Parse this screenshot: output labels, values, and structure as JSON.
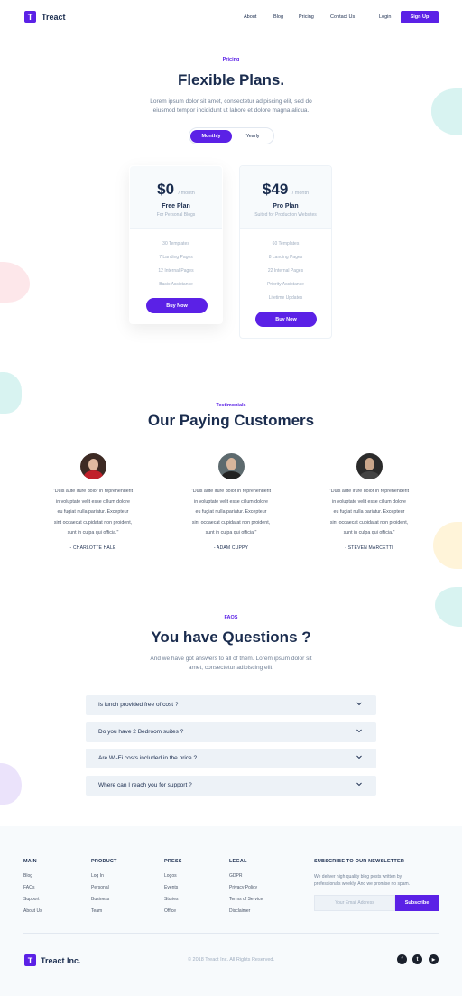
{
  "brand": {
    "logo_letter": "T",
    "name": "Treact",
    "footer_name": "Treact Inc.",
    "accent": "#5b21e6"
  },
  "nav": {
    "about": "About",
    "blog": "Blog",
    "pricing": "Pricing",
    "contact": "Contact Us",
    "login": "Login",
    "signup": "Sign Up"
  },
  "pricing": {
    "label": "Pricing",
    "title": "Flexible Plans.",
    "desc_1": "Lorem ipsum dolor sit amet, consectetur adipiscing elit, sed do",
    "desc_2": "eiusmod tempor incididunt ut labore et dolore magna aliqua.",
    "toggle": {
      "monthly": "Monthly",
      "yearly": "Yearly"
    },
    "plans": [
      {
        "price": "$0",
        "per": "/ month",
        "name": "Free Plan",
        "sub": "For Personal Blogs",
        "features": [
          "30 Templates",
          "7 Landing Pages",
          "12 Internal Pages",
          "Basic Assistance"
        ],
        "button": "Buy Now"
      },
      {
        "price": "$49",
        "per": "/ month",
        "name": "Pro Plan",
        "sub": "Suited for Production Websites",
        "features": [
          "60 Templates",
          "8 Landing Pages",
          "22 Internal Pages",
          "Priority Assistance",
          "Lifetime Updates"
        ],
        "button": "Buy Now"
      }
    ]
  },
  "testimonials": {
    "label": "Testimonials",
    "title": "Our Paying Customers",
    "items": [
      {
        "quote_1": "\"Duis aute irure dolor in reprehenderit",
        "quote_2": "in voluptate velit esse cillum dolore",
        "quote_3": "eu fugiat nulla pariatur. Excepteur",
        "quote_4": "sint occaecat cupidatat non proident,",
        "quote_5": "sunt in culpa qui officia.\"",
        "author": "- CHARLOTTE HALE"
      },
      {
        "quote_1": "\"Duis aute irure dolor in reprehenderit",
        "quote_2": "in voluptate velit esse cillum dolore",
        "quote_3": "eu fugiat nulla pariatur. Excepteur",
        "quote_4": "sint occaecat cupidatat non proident,",
        "quote_5": "sunt in culpa qui officia.\"",
        "author": "- ADAM CUPPY"
      },
      {
        "quote_1": "\"Duis aute irure dolor in reprehenderit",
        "quote_2": "in voluptate velit esse cillum dolore",
        "quote_3": "eu fugiat nulla pariatur. Excepteur",
        "quote_4": "sint occaecat cupidatat non proident,",
        "quote_5": "sunt in culpa qui officia.\"",
        "author": "- STEVEN MARCETTI"
      }
    ]
  },
  "faqs": {
    "label": "FAQS",
    "title": "You have Questions ?",
    "desc_1": "And we have got answers to all of them. Lorem ipsum dolor sit",
    "desc_2": "amet, consectetur adipiscing elit.",
    "items": [
      "Is lunch provided free of cost ?",
      "Do you have 2 Bedroom suites ?",
      "Are Wi-Fi costs included in the price ?",
      "Where can I reach you for support ?"
    ]
  },
  "footer": {
    "columns": [
      {
        "heading": "MAIN",
        "links": [
          "Blog",
          "FAQs",
          "Support",
          "About Us"
        ]
      },
      {
        "heading": "PRODUCT",
        "links": [
          "Log In",
          "Personal",
          "Business",
          "Team"
        ]
      },
      {
        "heading": "PRESS",
        "links": [
          "Logos",
          "Events",
          "Stories",
          "Office"
        ]
      },
      {
        "heading": "LEGAL",
        "links": [
          "GDPR",
          "Privacy Policy",
          "Terms of Service",
          "Disclaimer"
        ]
      }
    ],
    "newsletter": {
      "heading": "SUBSCRIBE TO OUR NEWSLETTER",
      "desc_1": "We deliver high quality blog posts written by",
      "desc_2": "professionals weekly. And we promise no spam.",
      "placeholder": "Your Email Address",
      "button": "Subscribe"
    },
    "copyright": "© 2018 Treact Inc. All Rights Reserved.",
    "social": {
      "facebook": "f",
      "twitter": "t",
      "youtube": "▶"
    }
  }
}
